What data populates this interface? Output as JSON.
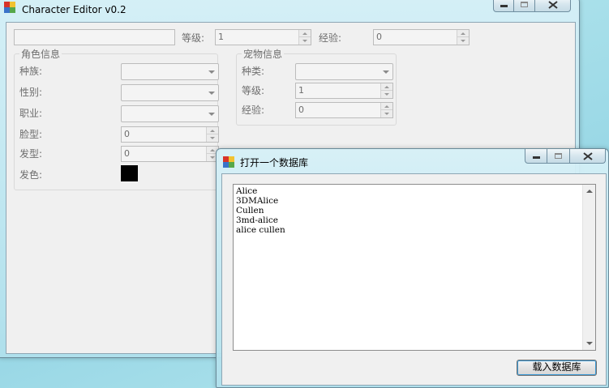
{
  "main_window": {
    "title": "Character Editor v0.2",
    "name_field": {
      "value": ""
    },
    "level_label": "等级:",
    "level_value": "1",
    "exp_label": "经验:",
    "exp_value": "0",
    "character_group": {
      "title": "角色信息",
      "race_label": "种族:",
      "race_value": "",
      "gender_label": "性别:",
      "gender_value": "",
      "job_label": "职业:",
      "job_value": "",
      "face_label": "脸型:",
      "face_value": "0",
      "hair_label": "发型:",
      "hair_value": "0",
      "haircolor_label": "发色:",
      "haircolor": "#000000"
    },
    "pet_group": {
      "title": "宠物信息",
      "species_label": "种类:",
      "species_value": "",
      "level_label": "等级:",
      "level_value": "1",
      "exp_label": "经验:",
      "exp_value": "0"
    }
  },
  "db_dialog": {
    "title": "打开一个数据库",
    "items": [
      "Alice",
      "3DMAlice",
      "Cullen",
      "3md-alice",
      "alice cullen"
    ],
    "load_button": "载入数据库"
  },
  "colors": {
    "close_glyph": "#333333",
    "icon_red": "#d8342a",
    "icon_yellow": "#f2c230",
    "icon_blue": "#3a73c9",
    "icon_green": "#56a84a"
  }
}
